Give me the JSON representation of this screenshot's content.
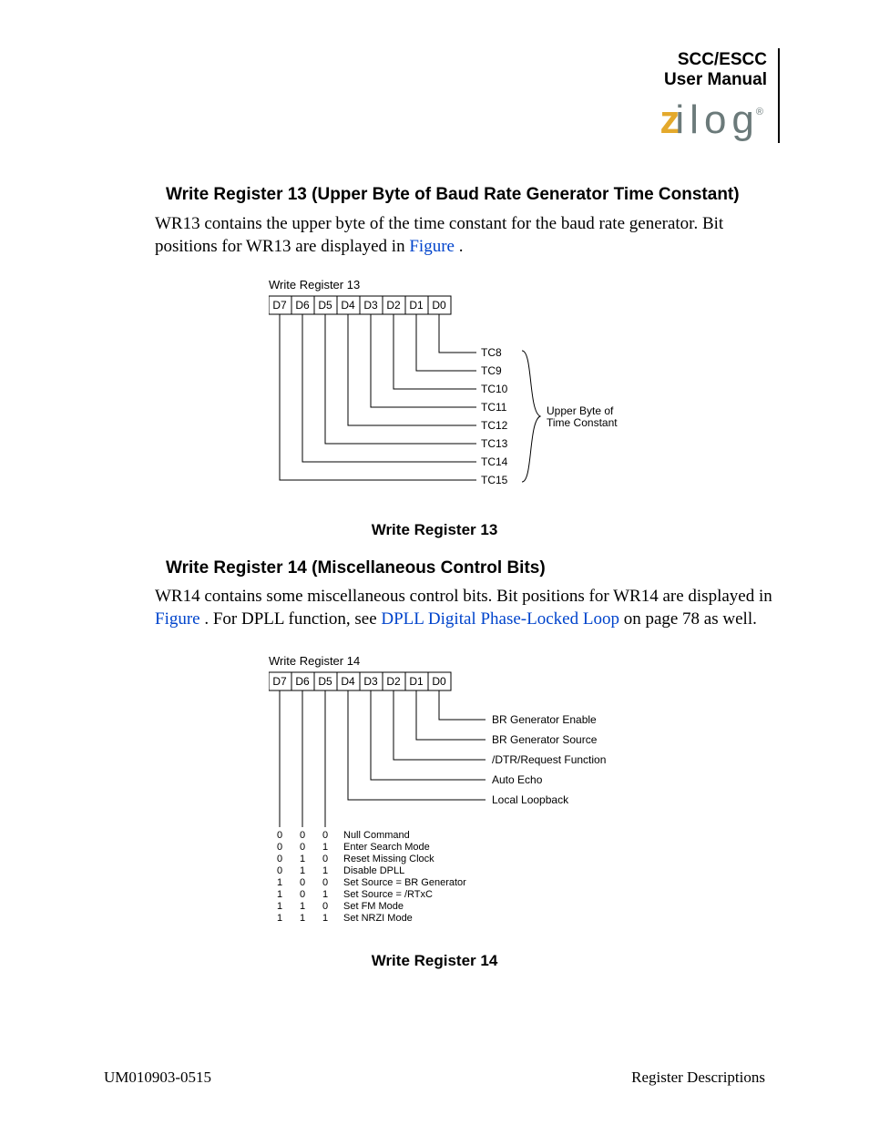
{
  "header": {
    "line1": "SCC/ESCC",
    "line2": "User Manual",
    "logo_z": "z",
    "logo_rest": "ilog",
    "reg": "®"
  },
  "section1": {
    "heading": "Write Register 13 (Upper Byte of Baud Rate Generator Time Constant)",
    "text_a": "WR13 contains the upper byte of the time constant for the baud rate generator. Bit positions for WR13 are displayed in ",
    "text_link": "Figure ",
    "text_b": ".",
    "caption": "Write Register 13"
  },
  "diagram1": {
    "title": "Write Register 13",
    "bits": [
      "D7",
      "D6",
      "D5",
      "D4",
      "D3",
      "D2",
      "D1",
      "D0"
    ],
    "labels": [
      "TC8",
      "TC9",
      "TC10",
      "TC11",
      "TC12",
      "TC13",
      "TC14",
      "TC15"
    ],
    "brace_label1": "Upper Byte of",
    "brace_label2": "Time Constant"
  },
  "section2": {
    "heading": "Write Register 14 (Miscellaneous Control Bits)",
    "text_a": "WR14 contains some miscellaneous control bits. Bit positions for WR14 are displayed in ",
    "text_link1": "Figure ",
    "text_b": ". For DPLL function, see ",
    "text_link2": "DPLL Digital Phase-Locked Loop",
    "text_c": " on page 78 as well.",
    "caption": "Write Register 14"
  },
  "diagram2": {
    "title": "Write Register 14",
    "bits": [
      "D7",
      "D6",
      "D5",
      "D4",
      "D3",
      "D2",
      "D1",
      "D0"
    ],
    "right_labels": [
      "BR Generator Enable",
      "BR Generator Source",
      "/DTR/Request Function",
      "Auto Echo",
      "Local Loopback"
    ],
    "table": {
      "rows": [
        {
          "b7": "0",
          "b6": "0",
          "b5": "0",
          "cmd": "Null Command"
        },
        {
          "b7": "0",
          "b6": "0",
          "b5": "1",
          "cmd": "Enter Search Mode"
        },
        {
          "b7": "0",
          "b6": "1",
          "b5": "0",
          "cmd": "Reset Missing Clock"
        },
        {
          "b7": "0",
          "b6": "1",
          "b5": "1",
          "cmd": "Disable DPLL"
        },
        {
          "b7": "1",
          "b6": "0",
          "b5": "0",
          "cmd": "Set Source = BR Generator"
        },
        {
          "b7": "1",
          "b6": "0",
          "b5": "1",
          "cmd": "Set Source = /RTxC"
        },
        {
          "b7": "1",
          "b6": "1",
          "b5": "0",
          "cmd": "Set FM Mode"
        },
        {
          "b7": "1",
          "b6": "1",
          "b5": "1",
          "cmd": "Set NRZI Mode"
        }
      ]
    }
  },
  "footer": {
    "left": "UM010903-0515",
    "right": "Register Descriptions"
  }
}
